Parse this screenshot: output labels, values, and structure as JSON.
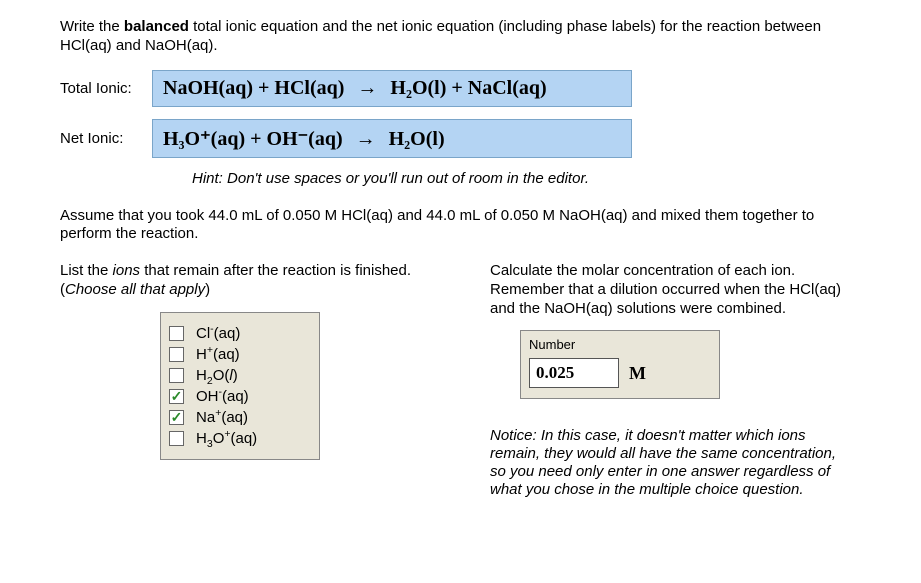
{
  "question": {
    "prefix": "Write the ",
    "bold": "balanced",
    "suffix": " total ionic equation and the net ionic equation (including phase labels) for the reaction between HCl(aq) and NaOH(aq)."
  },
  "total_ionic_label": "Total Ionic:",
  "net_ionic_label": "Net Ionic:",
  "eq_total_lhs": "NaOH(aq) + HCl(aq)",
  "eq_total_rhs": "H₂O(l) + NaCl(aq)",
  "eq_net_lhs": "H₃O⁺(aq) + OH⁻(aq)",
  "eq_net_rhs": "H₂O(l)",
  "hint_label": "Hint:  ",
  "hint_text": "Don't use spaces or you'll run out of room in the editor.",
  "assume_text": "Assume that you took 44.0 mL of 0.050 M HCl(aq) and 44.0 mL of 0.050 M NaOH(aq) and mixed them together to perform the reaction.",
  "ions_prompt_1": "List the ",
  "ions_prompt_italic": "ions",
  "ions_prompt_2": " that remain after the reaction is finished.  (",
  "ions_prompt_italic2": "Choose all that apply",
  "ions_prompt_3": ")",
  "ions": [
    {
      "label_html": "Cl<sup>-</sup>(aq)",
      "checked": false
    },
    {
      "label_html": "H<sup>+</sup>(aq)",
      "checked": false
    },
    {
      "label_html": "H<sub>2</sub>O(<i>l</i>)",
      "checked": false
    },
    {
      "label_html": "OH<sup>-</sup>(aq)",
      "checked": true
    },
    {
      "label_html": "Na<sup>+</sup>(aq)",
      "checked": true
    },
    {
      "label_html": "H<sub>3</sub>O<sup>+</sup>(aq)",
      "checked": false
    }
  ],
  "calc_prompt": "Calculate the molar concentration of each ion. Remember that a dilution occurred when the HCl(aq) and the NaOH(aq) solutions were combined.",
  "number_label": "Number",
  "number_value": "0.025",
  "unit": "M",
  "notice_label": "Notice:  ",
  "notice_text": "In this case, it doesn't matter which ions remain, they would all have the same concentration, so you need only enter in one answer regardless of what you chose in the multiple choice question."
}
